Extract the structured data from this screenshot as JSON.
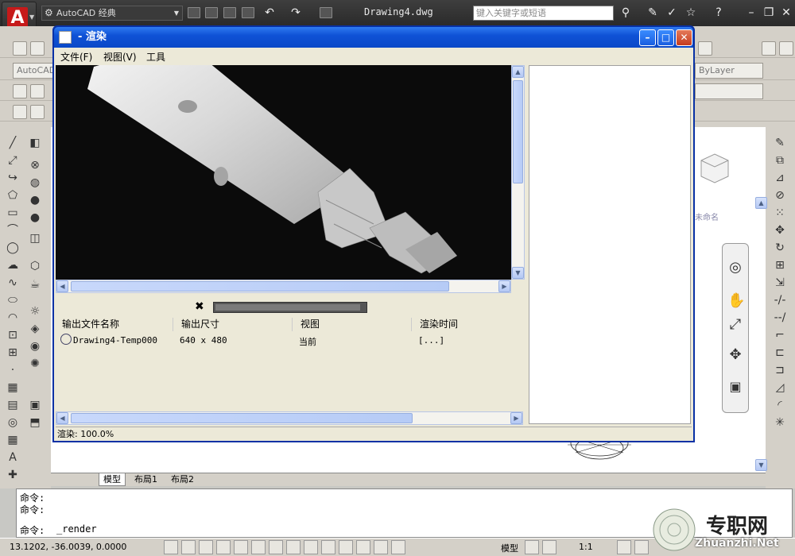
{
  "titlebar": {
    "workspace": "AutoCAD 经典",
    "document": "Drawing4.dwg",
    "search_placeholder": "键入关键字或短语"
  },
  "toolbars": {
    "style_combo": "AutoCAD",
    "bylayer": "ByLayer"
  },
  "drawing": {
    "viewcube_label": "未命名",
    "layout_tabs": [
      "模型",
      "布局1",
      "布局2"
    ]
  },
  "command": {
    "lines": [
      "命令:",
      "命令:"
    ],
    "prompt": "命令:",
    "current": "_render"
  },
  "statusbar": {
    "coords": "13.1202,  -36.0039, 0.0000",
    "model": "模型",
    "scale": "1:1"
  },
  "watermark": {
    "text": "专职网",
    "url": "Zhuanzhi.Net"
  },
  "render_window": {
    "title": "- 渲染",
    "menus": [
      "文件(F)",
      "视图(V)",
      "工具"
    ],
    "progress": 0.97,
    "columns": [
      "输出文件名称",
      "输出尺寸",
      "视图",
      "渲染时间"
    ],
    "rows": [
      {
        "name": "Drawing4-Temp000",
        "size": "640 x 480",
        "view": "当前",
        "time": "[...]"
      }
    ],
    "status": "渲染: 100.0%"
  }
}
